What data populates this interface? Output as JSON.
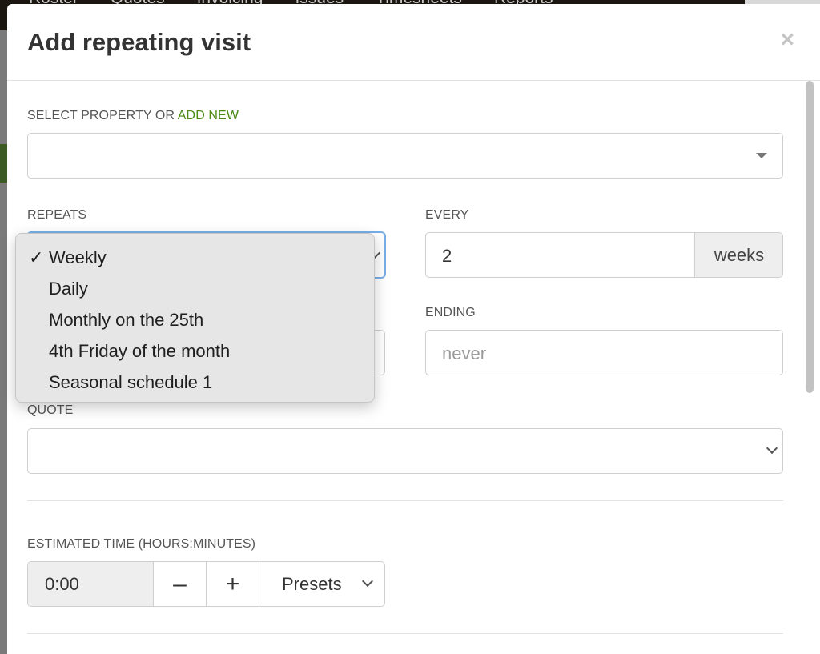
{
  "background": {
    "nav": [
      "Roster",
      "Quotes",
      "Invoicing",
      "Issues",
      "Timesheets",
      "Reports"
    ]
  },
  "modal": {
    "title": "Add repeating visit",
    "close_glyph": "×"
  },
  "property": {
    "label_prefix": "SELECT PROPERTY OR",
    "label_link": "ADD NEW",
    "value": ""
  },
  "repeats": {
    "label": "REPEATS",
    "selected": "Weekly",
    "check_glyph": "✓",
    "options": [
      "Weekly",
      "Daily",
      "Monthly on the 25th",
      "4th Friday of the month",
      "Seasonal schedule 1"
    ]
  },
  "every": {
    "label": "EVERY",
    "value": "2",
    "unit": "weeks"
  },
  "ending": {
    "label": "ENDING",
    "placeholder": "never"
  },
  "quote": {
    "label": "QUOTE",
    "value": ""
  },
  "estimated_time": {
    "label": "ESTIMATED TIME (HOURS:MINUTES)",
    "value": "0:00",
    "minus_glyph": "–",
    "plus_glyph": "+",
    "presets_label": "Presets"
  },
  "colors": {
    "accent": "#4b8a14",
    "dropdown_focus": "#79aee6"
  }
}
